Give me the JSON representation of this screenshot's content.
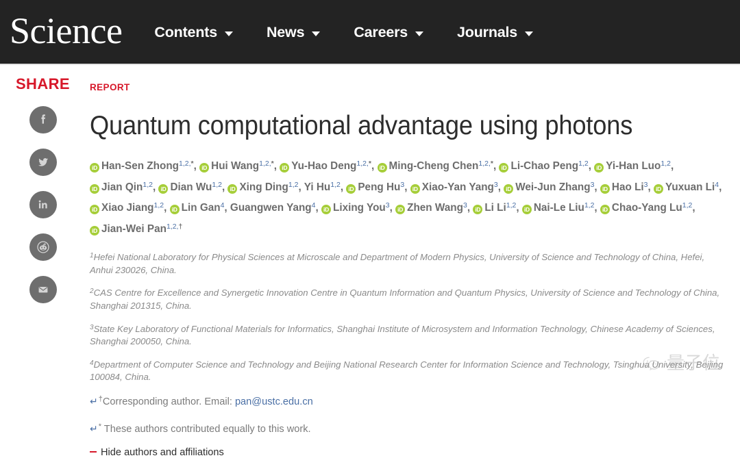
{
  "site": {
    "brand": "Science",
    "nav": [
      {
        "label": "Contents",
        "icon": "chevron-down-icon"
      },
      {
        "label": "News",
        "icon": "chevron-down-icon"
      },
      {
        "label": "Careers",
        "icon": "chevron-down-icon"
      },
      {
        "label": "Journals",
        "icon": "chevron-down-icon"
      }
    ]
  },
  "share": {
    "label": "SHARE",
    "items": [
      {
        "name": "facebook-icon",
        "title": "Share on Facebook"
      },
      {
        "name": "twitter-icon",
        "title": "Share on Twitter"
      },
      {
        "name": "linkedin-icon",
        "title": "Share on LinkedIn"
      },
      {
        "name": "reddit-icon",
        "title": "Share on Reddit"
      },
      {
        "name": "email-icon",
        "title": "Share by Email"
      }
    ]
  },
  "article": {
    "kicker": "REPORT",
    "title": "Quantum computational advantage using photons",
    "authors": [
      {
        "orcid": true,
        "name": "Han-Sen Zhong",
        "sup": "1,2,*"
      },
      {
        "orcid": true,
        "name": "Hui Wang",
        "sup": "1,2,*"
      },
      {
        "orcid": true,
        "name": "Yu-Hao Deng",
        "sup": "1,2,*"
      },
      {
        "orcid": true,
        "name": "Ming-Cheng Chen",
        "sup": "1,2,*"
      },
      {
        "orcid": true,
        "name": "Li-Chao Peng",
        "sup": "1,2"
      },
      {
        "orcid": true,
        "name": "Yi-Han Luo",
        "sup": "1,2"
      },
      {
        "orcid": true,
        "name": "Jian Qin",
        "sup": "1,2"
      },
      {
        "orcid": true,
        "name": "Dian Wu",
        "sup": "1,2"
      },
      {
        "orcid": true,
        "name": "Xing Ding",
        "sup": "1,2"
      },
      {
        "orcid": false,
        "name": "Yi Hu",
        "sup": "1,2"
      },
      {
        "orcid": true,
        "name": "Peng Hu",
        "sup": "3"
      },
      {
        "orcid": true,
        "name": "Xiao-Yan Yang",
        "sup": "3"
      },
      {
        "orcid": true,
        "name": "Wei-Jun Zhang",
        "sup": "3"
      },
      {
        "orcid": true,
        "name": "Hao Li",
        "sup": "3"
      },
      {
        "orcid": true,
        "name": "Yuxuan Li",
        "sup": "4"
      },
      {
        "orcid": true,
        "name": "Xiao Jiang",
        "sup": "1,2"
      },
      {
        "orcid": true,
        "name": "Lin Gan",
        "sup": "4"
      },
      {
        "orcid": false,
        "name": "Guangwen Yang",
        "sup": "4"
      },
      {
        "orcid": true,
        "name": "Lixing You",
        "sup": "3"
      },
      {
        "orcid": true,
        "name": "Zhen Wang",
        "sup": "3"
      },
      {
        "orcid": true,
        "name": "Li Li",
        "sup": "1,2"
      },
      {
        "orcid": true,
        "name": "Nai-Le Liu",
        "sup": "1,2"
      },
      {
        "orcid": true,
        "name": "Chao-Yang Lu",
        "sup": "1,2"
      },
      {
        "orcid": true,
        "name": "Jian-Wei Pan",
        "sup": "1,2,†",
        "last": true
      }
    ],
    "orcid_glyph": "iD",
    "affiliations": [
      {
        "marker": "1",
        "text": "Hefei National Laboratory for Physical Sciences at Microscale and Department of Modern Physics, University of Science and Technology of China, Hefei, Anhui 230026, China."
      },
      {
        "marker": "2",
        "text": "CAS Centre for Excellence and Synergetic Innovation Centre in Quantum Information and Quantum Physics, University of Science and Technology of China, Shanghai 201315, China."
      },
      {
        "marker": "3",
        "text": "State Key Laboratory of Functional Materials for Informatics, Shanghai Institute of Microsystem and Information Technology, Chinese Academy of Sciences, Shanghai 200050, China."
      },
      {
        "marker": "4",
        "text": "Department of Computer Science and Technology and Beijing National Research Center for Information Science and Technology, Tsinghua University, Beijing 100084, China."
      }
    ],
    "footnotes": [
      {
        "return": "↵",
        "marker": "†",
        "text": "Corresponding author. Email: ",
        "link": "pan@ustc.edu.cn"
      },
      {
        "return": "↵",
        "marker": "*",
        "text": " These authors contributed equally to this work.",
        "link": ""
      }
    ],
    "hide_authors_label": "Hide authors and affiliations"
  },
  "watermark": {
    "icon": "wechat-icon",
    "text": "量子位"
  },
  "colors": {
    "header_bg": "#232323",
    "accent_red": "#d7182a",
    "orcid_green": "#a6ce39",
    "link_blue": "#4a6fa5",
    "author_gray": "#6d6d6d",
    "affil_gray": "#8a8a8a",
    "share_circle": "#6e6e6e"
  }
}
